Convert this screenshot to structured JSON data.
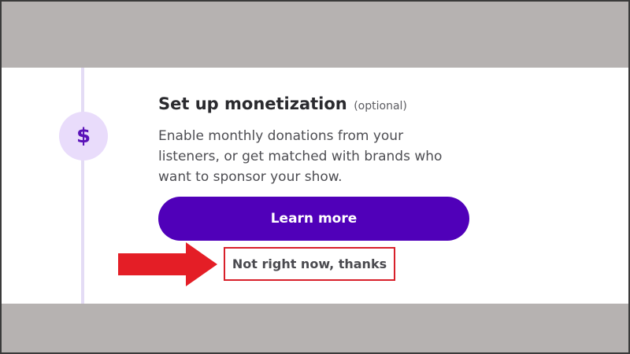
{
  "step": {
    "icon": "dollar-icon",
    "icon_glyph": "$",
    "title": "Set up monetization",
    "title_suffix": "(optional)",
    "description": "Enable monthly donations from your listeners, or get matched with brands who want to sponsor your show."
  },
  "actions": {
    "primary_label": "Learn more",
    "secondary_label": "Not right now, thanks"
  },
  "annotation": {
    "arrow_icon": "red-arrow-icon",
    "highlight_color": "#d8202a"
  },
  "colors": {
    "primary": "#5000b9",
    "icon_bg": "#e9dcfb",
    "icon_fg": "#5a12b8",
    "band": "#b6b2b1"
  }
}
